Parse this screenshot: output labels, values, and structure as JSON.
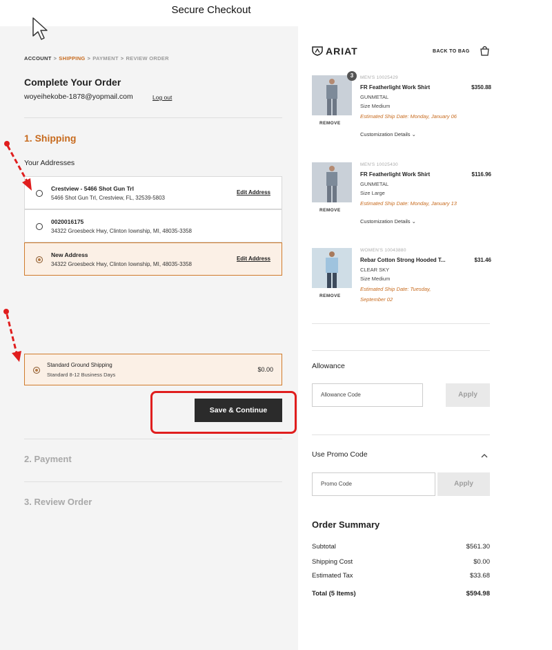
{
  "header": {
    "title": "Secure Checkout"
  },
  "breadcrumb": {
    "account": "ACCOUNT",
    "shipping": "SHIPPING",
    "payment": "PAYMENT",
    "review": "REVIEW ORDER",
    "sep": ">"
  },
  "checkout": {
    "title": "Complete Your Order",
    "email": "woyeihekobe-1878@yopmail.com",
    "logout": "Log out"
  },
  "shipping": {
    "step_title": "1. Shipping",
    "addresses_label": "Your Addresses",
    "addresses": [
      {
        "name": "Crestview - 5466 Shot Gun Trl",
        "line": "5466 Shot Gun Trl, Crestview, FL, 32539-5803",
        "edit": "Edit Address",
        "selected": false
      },
      {
        "name": "0020016175",
        "line": "34322 Groesbeck Hwy, Clinton Iownship, MI, 48035-3358",
        "edit": "",
        "selected": false
      },
      {
        "name": "New Address",
        "line": "34322 Groesbeck Hwy, Clinton Iownship, MI, 48035-3358",
        "edit": "Edit Address",
        "selected": true
      }
    ],
    "method": {
      "name": "Standard Ground Shipping",
      "detail": "Standard 8-12 Business Days",
      "price": "$0.00"
    },
    "save_label": "Save & Continue"
  },
  "steps": {
    "payment": "2. Payment",
    "review": "3. Review Order"
  },
  "sidebar": {
    "logo": "ARIAT",
    "back_to_bag": "BACK TO BAG",
    "items": [
      {
        "sku": "MEN'S 10025429",
        "name": "FR Featherlight Work Shirt",
        "price": "$350.88",
        "color": "GUNMETAL",
        "size": "Size Medium",
        "ship": "Estimated Ship Date: Monday, January 06",
        "custom": "Customization Details",
        "remove": "REMOVE",
        "qty": "3"
      },
      {
        "sku": "MEN'S 10025430",
        "name": "FR Featherlight Work Shirt",
        "price": "$116.96",
        "color": "GUNMETAL",
        "size": "Size Large",
        "ship": "Estimated Ship Date: Monday, January 13",
        "custom": "Customization Details",
        "remove": "REMOVE",
        "qty": ""
      },
      {
        "sku": "WOMEN'S 10043880",
        "name": "Rebar Cotton Strong Hooded T...",
        "price": "$31.46",
        "color": "CLEAR SKY",
        "size": "Size Medium",
        "ship": "Estimated Ship Date: Tuesday, September 02",
        "custom": "",
        "remove": "REMOVE",
        "qty": ""
      }
    ],
    "allowance": {
      "label": "Allowance",
      "placeholder": "Allowance Code",
      "apply": "Apply"
    },
    "promo": {
      "label": "Use Promo Code",
      "placeholder": "Promo Code",
      "apply": "Apply"
    },
    "summary": {
      "title": "Order Summary",
      "rows": [
        {
          "label": "Subtotal",
          "value": "$561.30"
        },
        {
          "label": "Shipping Cost",
          "value": "$0.00"
        },
        {
          "label": "Estimated Tax",
          "value": "$33.68"
        },
        {
          "label": "Total (5 Items)",
          "value": "$594.98"
        }
      ]
    }
  },
  "colors": {
    "accent": "#c76a1d",
    "annotation": "#e01e1e",
    "button": "#2b2b2b"
  }
}
